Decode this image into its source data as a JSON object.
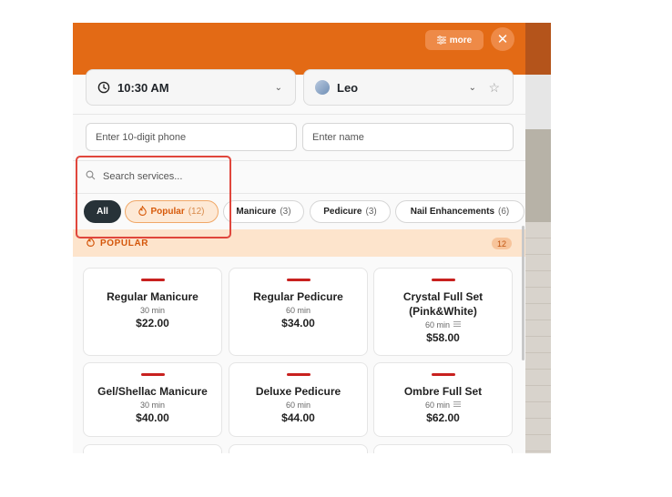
{
  "header": {
    "more_label": "more",
    "close_icon": "close-icon",
    "filter_icon": "sliders-icon"
  },
  "booking": {
    "time_value": "10:30 AM",
    "staff_value": "Leo",
    "phone_placeholder": "Enter 10-digit phone",
    "name_placeholder": "Enter name"
  },
  "search": {
    "placeholder": "Search services..."
  },
  "categories": [
    {
      "label": "All",
      "count": ""
    },
    {
      "label": "Popular",
      "count": "(12)"
    },
    {
      "label": "Manicure",
      "count": "(3)"
    },
    {
      "label": "Pedicure",
      "count": "(3)"
    },
    {
      "label": "Nail Enhancements",
      "count": "(6)"
    }
  ],
  "section": {
    "title": "POPULAR",
    "count": "12"
  },
  "services": [
    {
      "name": "Regular Manicure",
      "duration": "30 min",
      "price": "$22.00",
      "has_options": false
    },
    {
      "name": "Regular Pedicure",
      "duration": "60 min",
      "price": "$34.00",
      "has_options": false
    },
    {
      "name": "Crystal Full Set (Pink&White)",
      "duration": "60 min",
      "price": "$58.00",
      "has_options": true
    },
    {
      "name": "Gel/Shellac Manicure",
      "duration": "30 min",
      "price": "$40.00",
      "has_options": false
    },
    {
      "name": "Deluxe Pedicure",
      "duration": "60 min",
      "price": "$44.00",
      "has_options": false
    },
    {
      "name": "Ombre Full Set",
      "duration": "60 min",
      "price": "$62.00",
      "has_options": true
    }
  ],
  "colors": {
    "brand_orange": "#e36a15",
    "popular_tint": "#fde4cc",
    "active_chip": "#273238",
    "accent_red": "#c8211f",
    "highlight_outline": "#e0463c"
  }
}
